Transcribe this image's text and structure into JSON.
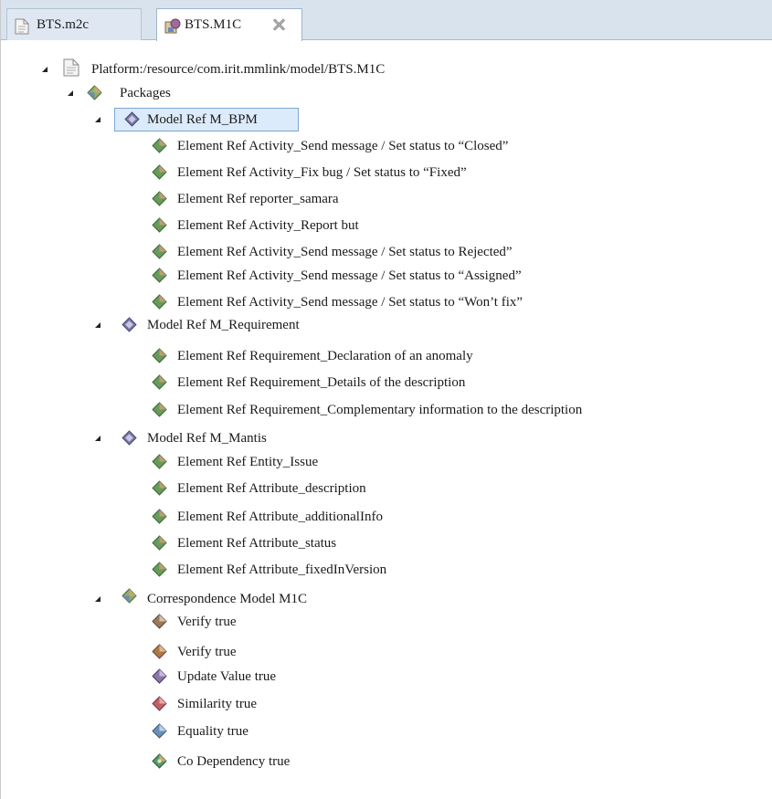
{
  "tabs": [
    {
      "label": "BTS.m2c",
      "icon": "file-icon",
      "active": false
    },
    {
      "label": "BTS.M1C",
      "icon": "model-file-icon",
      "active": true,
      "closable": true
    }
  ],
  "tree": {
    "root": {
      "label": "Platform:/resource/com.irit.mmlink/model/BTS.M1C",
      "icon": "file-icon"
    },
    "packages": {
      "label": "Packages"
    },
    "model_bpm": {
      "label": "Model Ref M_BPM",
      "selected": true,
      "items": [
        "Element Ref Activity_Send message / Set status to “Closed”",
        "Element Ref Activity_Fix bug / Set status to “Fixed”",
        "Element Ref reporter_samara",
        "Element Ref Activity_Report but",
        "Element Ref Activity_Send message / Set status to Rejected”",
        "Element Ref Activity_Send message / Set status to “Assigned”",
        "Element Ref Activity_Send message / Set status to “Won’t fix”"
      ]
    },
    "model_requirement": {
      "label": "Model Ref M_Requirement",
      "items": [
        "Element Ref Requirement_Declaration of an anomaly",
        "Element Ref Requirement_Details of the description",
        "Element Ref Requirement_Complementary information to the description"
      ]
    },
    "model_mantis": {
      "label": "Model Ref M_Mantis",
      "items": [
        "Element Ref Entity_Issue",
        "Element Ref Attribute_description",
        "Element Ref Attribute_additionalInfo",
        "Element Ref Attribute_status",
        "Element Ref Attribute_fixedInVersion"
      ]
    },
    "correspondence": {
      "label": "Correspondence Model M1C",
      "items": [
        {
          "label": "Verify true",
          "icon_color": "#9a7a5a"
        },
        {
          "label": "Verify true",
          "icon_color": "#b0784a"
        },
        {
          "label": "Update Value true",
          "icon_color": "#8a78a8"
        },
        {
          "label": "Similarity true",
          "icon_color": "#c0606a"
        },
        {
          "label": "Equality true",
          "icon_color": "#6a90b8"
        },
        {
          "label": "Co Dependency true",
          "icon_color": "#5a9a6a"
        }
      ]
    }
  },
  "colors": {
    "tabbar_bg": "#d9e3ee",
    "selection_bg": "#dcebfb",
    "selection_border": "#7fa7d4",
    "element_icon": "#6a9a5a",
    "model_icon": "#6a6a9a"
  }
}
